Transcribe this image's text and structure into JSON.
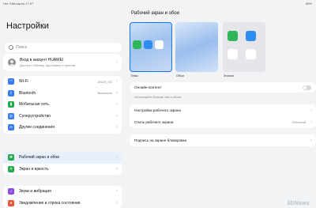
{
  "status": {
    "left": "Нет SIM-карты 17:07",
    "right": "65%"
  },
  "left": {
    "title": "Настройки",
    "search_placeholder": "Поиск",
    "account": {
      "title": "Вход в аккаунт HUAWEI",
      "subtitle": "Доступ к Облаку, AppGallery и прочим"
    },
    "group1": [
      {
        "label": "Wi-Fi",
        "value": "ASUS_5G"
      },
      {
        "label": "Bluetooth",
        "value": "Включено"
      },
      {
        "label": "Мобильная сеть"
      },
      {
        "label": "Суперустройство"
      },
      {
        "label": "Другие соединения"
      }
    ],
    "group2": [
      {
        "label": "Рабочий экран и обои"
      },
      {
        "label": "Экран и яркость"
      }
    ],
    "group3": [
      {
        "label": "Звуки и вибрация"
      },
      {
        "label": "Уведомления и строка состояния"
      }
    ]
  },
  "right": {
    "title": "Рабочий экран и обои",
    "thumb_labels": [
      "Темы",
      "Обои",
      "Значки"
    ],
    "online_content": "Онлайн-контент",
    "online_hint": "Используйте больше тем и обоев.",
    "home_settings": "Настройки рабочего экрана",
    "home_style": "Стиль рабочего экрана",
    "home_style_value": "Обычный",
    "lock_caption": "Подпись на экране блокировки"
  },
  "watermark": "3DNews",
  "colors": {
    "accent": "#1a73e8",
    "selected_row": "#e7f0fb"
  }
}
